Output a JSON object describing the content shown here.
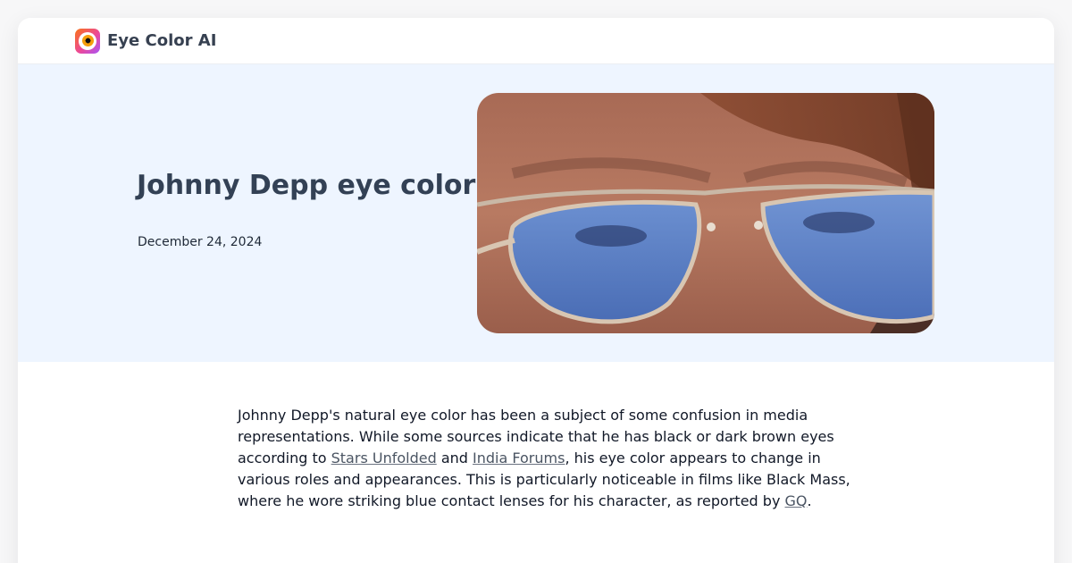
{
  "brand": {
    "name": "Eye Color AI",
    "logo_icon": "eye-logo-icon"
  },
  "hero": {
    "title": "Johnny Depp eye color",
    "date": "December 24, 2024",
    "image_icon": "portrait-sunglasses-photo"
  },
  "article": {
    "p1_before_link1": "Johnny Depp's natural eye color has been a subject of some confusion in media representations. While some sources indicate that he has black or dark brown eyes according to ",
    "link1": "Stars Unfolded",
    "p1_between_links": " and ",
    "link2": "India Forums",
    "p1_after_link2": ", his eye color appears to change in various roles and appearances. This is particularly noticeable in films like Black Mass, where he wore striking blue contact lenses for his character, as reported by ",
    "link3": "GQ",
    "p1_end": "."
  },
  "colors": {
    "hero_bg": "#eef5ff",
    "title": "#334155",
    "lens_blue": "#5b7fc4"
  }
}
